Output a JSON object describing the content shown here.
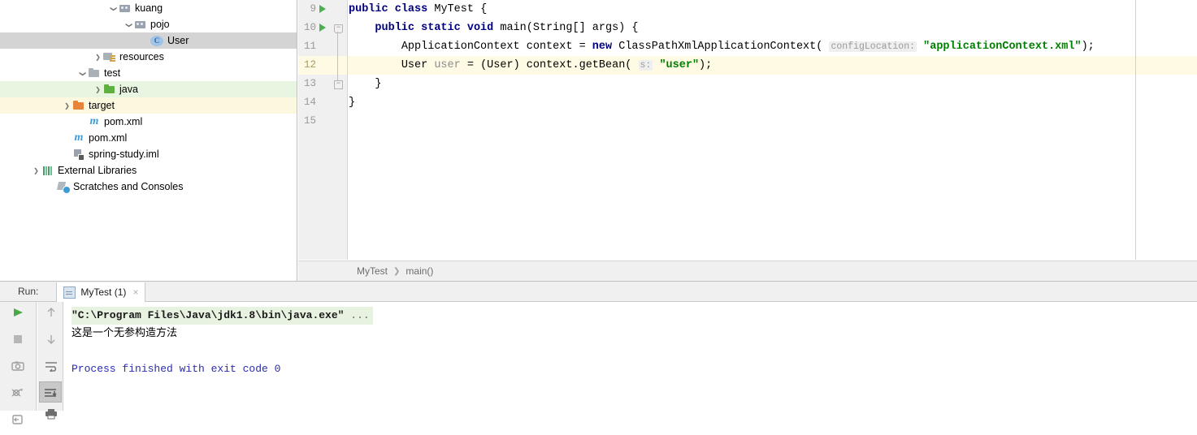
{
  "project_tree": {
    "name": "project-tree",
    "items": [
      {
        "label": "kuang",
        "icon": "package-icon",
        "indent": 7,
        "twisty": "down",
        "state": "normal"
      },
      {
        "label": "pojo",
        "icon": "package-icon",
        "indent": 8,
        "twisty": "down",
        "state": "normal"
      },
      {
        "label": "User",
        "icon": "java-class-icon",
        "indent": 9,
        "twisty": "none",
        "state": "selected"
      },
      {
        "label": "resources",
        "icon": "resources-folder-icon",
        "indent": 6,
        "twisty": "right",
        "state": "normal"
      },
      {
        "label": "test",
        "icon": "folder-icon",
        "indent": 5,
        "twisty": "down",
        "state": "normal"
      },
      {
        "label": "java",
        "icon": "test-source-folder-icon",
        "indent": 6,
        "twisty": "right",
        "state": "test-source"
      },
      {
        "label": "target",
        "icon": "excluded-folder-icon",
        "indent": 4,
        "twisty": "right",
        "state": "excluded"
      },
      {
        "label": "pom.xml",
        "icon": "maven-icon",
        "indent": 5,
        "twisty": "none",
        "state": "normal"
      },
      {
        "label": "pom.xml",
        "icon": "maven-icon",
        "indent": 4,
        "twisty": "none",
        "state": "normal"
      },
      {
        "label": "spring-study.iml",
        "icon": "module-iml-icon",
        "indent": 4,
        "twisty": "none",
        "state": "normal"
      },
      {
        "label": "External Libraries",
        "icon": "external-libraries-icon",
        "indent": 2,
        "twisty": "right",
        "state": "normal"
      },
      {
        "label": "Scratches and Consoles",
        "icon": "scratches-icon",
        "indent": 3,
        "twisty": "none",
        "state": "normal"
      }
    ]
  },
  "editor": {
    "name": "code-editor",
    "first_line_number": 9,
    "current_line": 12,
    "gutter_lines": [
      {
        "number": "9",
        "run_marker": true,
        "fold": "none"
      },
      {
        "number": "10",
        "run_marker": true,
        "fold": "top"
      },
      {
        "number": "11",
        "run_marker": false,
        "fold": "none"
      },
      {
        "number": "12",
        "run_marker": false,
        "fold": "none"
      },
      {
        "number": "13",
        "run_marker": false,
        "fold": "bottom"
      },
      {
        "number": "14",
        "run_marker": false,
        "fold": "none"
      },
      {
        "number": "15",
        "run_marker": false,
        "fold": "none"
      }
    ],
    "code": {
      "l9": {
        "kw1": "public",
        "kw2": "class",
        "name": "MyTest",
        "brace": "{"
      },
      "l10": {
        "kw1": "public",
        "kw2": "static",
        "kw3": "void",
        "sig": "main(String[] args) {"
      },
      "l11": {
        "type": "ApplicationContext",
        "var": "context",
        "eq": "=",
        "kw": "new",
        "ctor": "ClassPathXmlApplicationContext(",
        "hint": "configLocation:",
        "str": "\"applicationContext.xml\"",
        "tail": ");"
      },
      "l12": {
        "type": "User",
        "var": "user",
        "eq": "=",
        "cast": "(User)",
        "call": "context.getBean(",
        "hint": "s:",
        "str": "\"user\"",
        "tail": ");"
      },
      "l13": {
        "brace": "}"
      },
      "l14": {
        "brace": "}"
      },
      "l15": {
        "brace": ""
      }
    },
    "breadcrumbs": {
      "name": "editor-breadcrumbs",
      "items": [
        "MyTest",
        "main()"
      ],
      "separator": "❯"
    }
  },
  "run_panel": {
    "name": "run-tool-window",
    "label": "Run:",
    "tab": {
      "title": "MyTest (1)",
      "close": "×"
    },
    "toolbar_left": [
      {
        "name": "rerun-button",
        "glyph": "play-icon"
      },
      {
        "name": "stop-button",
        "glyph": "stop-icon"
      },
      {
        "name": "screenshot-button",
        "glyph": "camera-icon"
      },
      {
        "name": "dump-threads-button",
        "glyph": "thread-dump-icon"
      },
      {
        "name": "restore-layout-button",
        "glyph": "restore-layout-icon"
      }
    ],
    "toolbar_right": [
      {
        "name": "prev-occurrence-button",
        "glyph": "arrow-up-icon",
        "pressed": false
      },
      {
        "name": "next-occurrence-button",
        "glyph": "arrow-down-icon",
        "pressed": false
      },
      {
        "name": "soft-wrap-button",
        "glyph": "soft-wrap-icon",
        "pressed": false
      },
      {
        "name": "scroll-to-end-button",
        "glyph": "scroll-to-end-icon",
        "pressed": true
      },
      {
        "name": "print-button",
        "glyph": "print-icon",
        "pressed": false
      }
    ],
    "console": {
      "name": "console-output",
      "lines": [
        {
          "text": "\"C:\\Program Files\\Java\\jdk1.8\\bin\\java.exe\" ...",
          "style": "command"
        },
        {
          "text": "这是一个无参构造方法",
          "style": "output"
        },
        {
          "text": "",
          "style": "output"
        },
        {
          "text": "Process finished with exit code 0",
          "style": "exit"
        }
      ]
    }
  },
  "colors": {
    "keyword": "#000080",
    "string": "#008000",
    "hint_text": "#9a9a9a",
    "current_line_bg": "#fffae3",
    "selection_bg": "#d4d4d4",
    "test_source_bg": "#e8f5e0",
    "excluded_bg": "#fcf8e0",
    "command_bg": "#e7f2e1",
    "exit_text": "#2b2bb0",
    "run_green": "#4caf50"
  }
}
